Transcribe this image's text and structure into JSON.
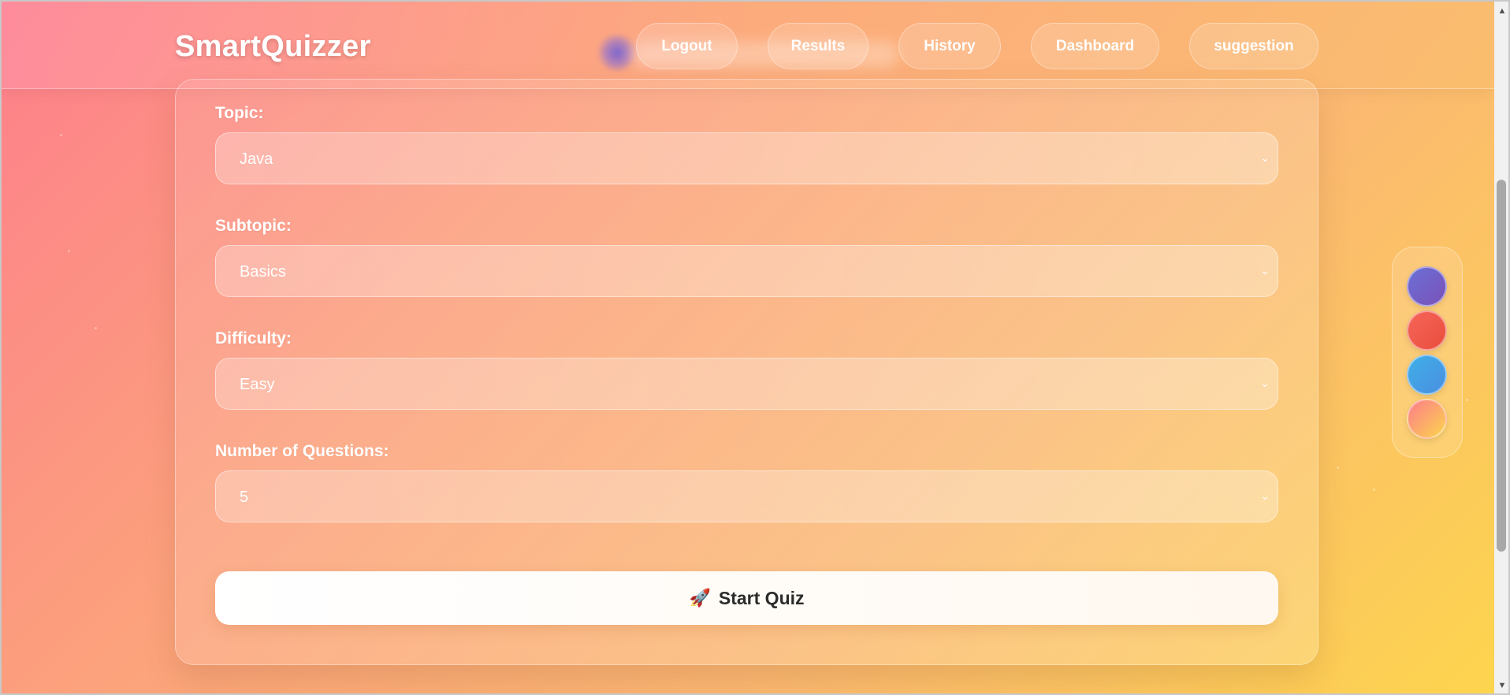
{
  "app": {
    "brand": "SmartQuizzer"
  },
  "nav": {
    "items": [
      {
        "label": "Logout"
      },
      {
        "label": "Results"
      },
      {
        "label": "History"
      },
      {
        "label": "Dashboard"
      },
      {
        "label": "suggestion"
      }
    ]
  },
  "form": {
    "topic": {
      "label": "Topic:",
      "value": "Java"
    },
    "subtopic": {
      "label": "Subtopic:",
      "value": "Basics"
    },
    "difficulty": {
      "label": "Difficulty:",
      "value": "Easy"
    },
    "num_questions": {
      "label": "Number of Questions:",
      "value": "5"
    },
    "start_button": {
      "icon": "🚀",
      "label": "Start Quiz"
    }
  },
  "theme_switcher": {
    "swatches": [
      {
        "name": "purple",
        "colors": [
          "#6b6fd6",
          "#7a52b8"
        ]
      },
      {
        "name": "red",
        "colors": [
          "#f6665a",
          "#e94d3c"
        ]
      },
      {
        "name": "blue",
        "colors": [
          "#3fb0e8",
          "#4a8ee0"
        ]
      },
      {
        "name": "sunset",
        "colors": [
          "#fb7c8a",
          "#fdd54d"
        ]
      }
    ]
  },
  "icons": {
    "dropdown": "chevron-down-icon",
    "scroll_up": "scroll-up-arrow-icon",
    "scroll_down": "scroll-down-arrow-icon"
  }
}
